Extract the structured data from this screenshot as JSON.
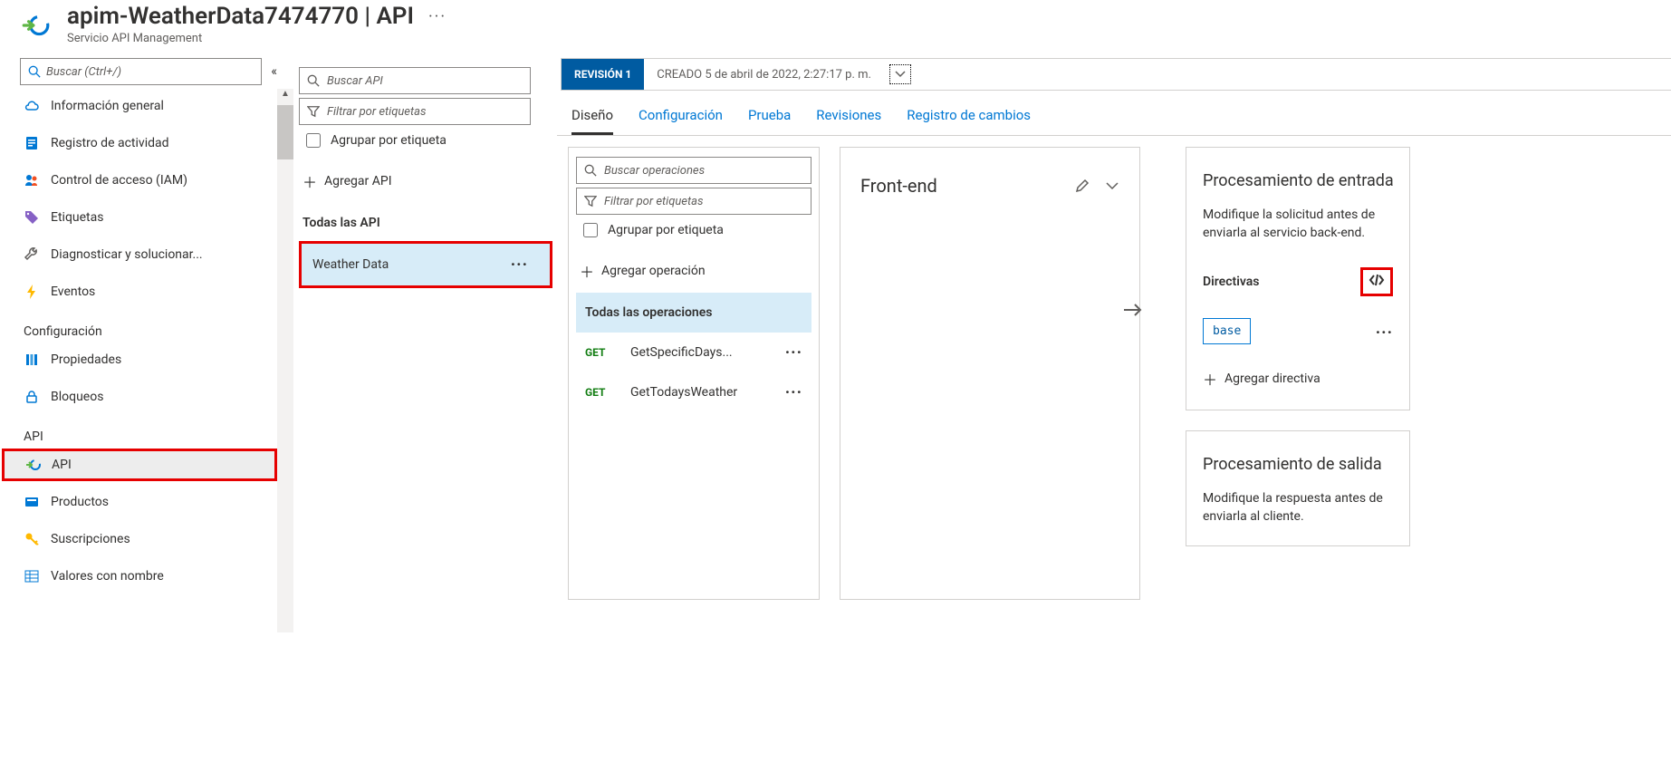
{
  "header": {
    "title": "apim-WeatherData7474770 | API",
    "subtitle": "Servicio API Management"
  },
  "sidebar": {
    "search_placeholder": "Buscar (Ctrl+/)",
    "items": [
      {
        "label": "Información general"
      },
      {
        "label": "Registro de actividad"
      },
      {
        "label": "Control de acceso (IAM)"
      },
      {
        "label": "Etiquetas"
      },
      {
        "label": "Diagnosticar y solucionar..."
      },
      {
        "label": "Eventos"
      }
    ],
    "section_config": "Configuración",
    "config_items": [
      {
        "label": "Propiedades"
      },
      {
        "label": "Bloqueos"
      }
    ],
    "section_api": "API",
    "api_items": [
      {
        "label": "API"
      },
      {
        "label": "Productos"
      },
      {
        "label": "Suscripciones"
      },
      {
        "label": "Valores con nombre"
      }
    ]
  },
  "api_col": {
    "search_placeholder": "Buscar API",
    "filter_placeholder": "Filtrar por etiquetas",
    "group_label": "Agrupar por etiqueta",
    "add_label": "Agregar API",
    "all_apis_label": "Todas las API",
    "api_name": "Weather Data"
  },
  "revision": {
    "badge": "REVISIÓN 1",
    "created": "CREADO 5 de abril de 2022, 2:27:17 p. m."
  },
  "tabs": {
    "design": "Diseño",
    "config": "Configuración",
    "test": "Prueba",
    "revisions": "Revisiones",
    "changelog": "Registro de cambios"
  },
  "ops_panel": {
    "search_placeholder": "Buscar operaciones",
    "filter_placeholder": "Filtrar por etiquetas",
    "group_label": "Agrupar por etiqueta",
    "add_op_label": "Agregar operación",
    "all_ops_label": "Todas las operaciones",
    "ops": [
      {
        "method": "GET",
        "name": "GetSpecificDays..."
      },
      {
        "method": "GET",
        "name": "GetTodaysWeather"
      }
    ]
  },
  "frontend": {
    "title": "Front-end"
  },
  "inbound": {
    "title": "Procesamiento de entrada",
    "desc": "Modifique la solicitud antes de enviarla al servicio back-end.",
    "directives_label": "Directivas",
    "base_label": "base",
    "add_label": "Agregar directiva"
  },
  "outbound": {
    "title": "Procesamiento de salida",
    "desc": "Modifique la respuesta antes de enviarla al cliente."
  }
}
